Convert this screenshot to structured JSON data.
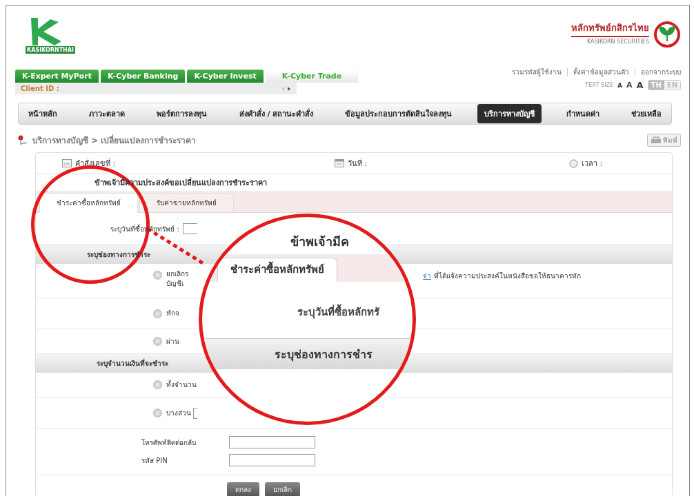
{
  "header": {
    "logo_text": "KASIKORNTHAI",
    "brand_name": "หลักทรัพย์กสิกรไทย",
    "brand_subtitle": "KASIKORN SECURITIES"
  },
  "product_tabs": [
    {
      "label": "K-Expert MyPort",
      "selected": false
    },
    {
      "label": "K-Cyber Banking",
      "selected": false
    },
    {
      "label": "K-Cyber Invest",
      "selected": false
    },
    {
      "label": "K-Cyber Trade",
      "selected": true
    }
  ],
  "client_id_label": "Client ID :",
  "user_links": [
    "รวมรหัสผู้ใช้งาน",
    "ตั้งค่าข้อมูลส่วนตัว",
    "ออกจากระบบ"
  ],
  "text_size": {
    "label": "TEXT SIZE",
    "sizes": [
      "A",
      "A",
      "A"
    ]
  },
  "languages": [
    {
      "label": "TH",
      "selected": true
    },
    {
      "label": "EN",
      "selected": false
    }
  ],
  "nav": [
    {
      "label": "หน้าหลัก",
      "selected": false
    },
    {
      "label": "ภาวะตลาด",
      "selected": false
    },
    {
      "label": "พอร์ตการลงทุน",
      "selected": false
    },
    {
      "label": "ส่งคำสั่ง / สถานะคำสั่ง",
      "selected": false
    },
    {
      "label": "ข้อมูลประกอบการตัดสินใจลงทุน",
      "selected": false
    },
    {
      "label": "บริการทางบัญชี",
      "selected": true
    },
    {
      "label": "กำหนดค่า",
      "selected": false
    },
    {
      "label": "ช่วยเหลือ",
      "selected": false
    }
  ],
  "breadcrumb": "บริการทางบัญชี > เปลี่ยนแปลงการชำระราคา",
  "print_button": "พิมพ์",
  "form": {
    "info": [
      {
        "kind": "order",
        "label": "คำสั่งเลขที่ :"
      },
      {
        "kind": "date",
        "label": "วันที่ :"
      },
      {
        "kind": "time",
        "label": "เวลา :"
      }
    ],
    "title": "ข้าพเจ้ามีความประสงค์ขอเปลี่ยนแปลงการชำระราคา",
    "tabs": [
      {
        "label": "ชำระค่าซื้อหลักทรัพย์",
        "selected": true
      },
      {
        "label": "รับค่าขายหลักทรัพย์",
        "selected": false
      }
    ],
    "date_label": "ระบุวันที่ซื้อหลักทรัพย์ :",
    "sections": [
      {
        "heading": "ระบุช่องทางการชำระ",
        "options": [
          {
            "lines": [
              "ยกเลิกร",
              "บัญชีเ"
            ],
            "link": "จ่า",
            "tail": "ที่ได้แจ้งความประสงค์ในหนังสือขอให้ธนาคารหัก",
            "selected": false,
            "has_field": false
          },
          {
            "lines": [
              "หักจ"
            ],
            "selected": false,
            "has_field": false
          },
          {
            "lines": [
              "ผ่าน"
            ],
            "selected": false,
            "has_field": false
          }
        ]
      },
      {
        "heading": "ระบุจำนวนเงินที่จะชำระ",
        "options": [
          {
            "lines": [
              "ทั้งจำนวน"
            ],
            "selected": false,
            "has_field": false
          },
          {
            "lines": [
              "บางส่วน"
            ],
            "selected": false,
            "has_field": true
          }
        ]
      }
    ],
    "contact_fields": [
      {
        "label": "โทรศัพท์ติดต่อกลับ"
      },
      {
        "label": "รหัส PIN"
      }
    ],
    "buttons": [
      "ตกลง",
      "ยกเลิก"
    ]
  },
  "magnifier": {
    "heading": "ข้าพเจ้ามีค",
    "tab": "ชำระค่าซื้อหลักทรัพย์",
    "field_label": "ระบุวันที่ซื้อหลักทรั",
    "section_heading": "ระบุช่องทางการชำร"
  }
}
